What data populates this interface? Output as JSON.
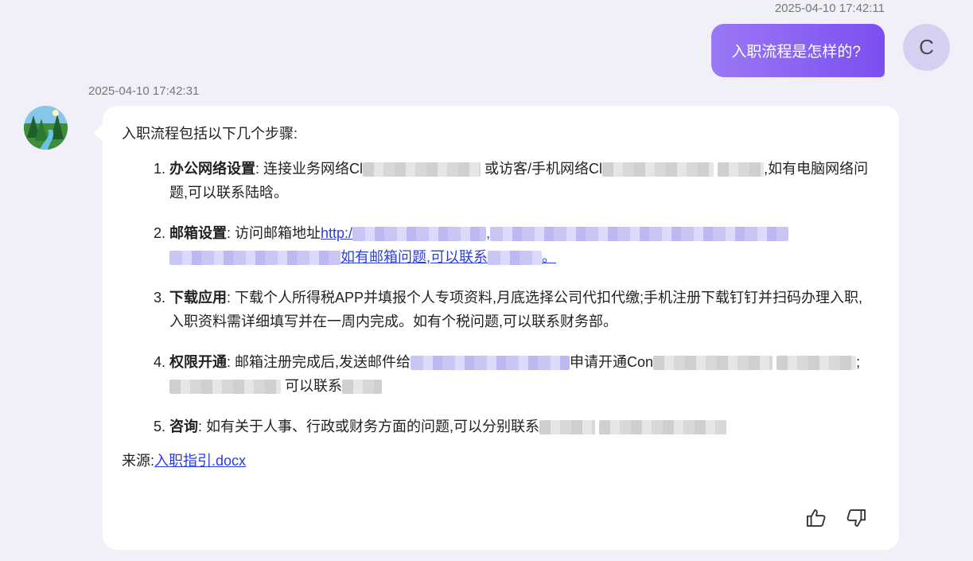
{
  "user_message": {
    "timestamp": "2025-04-10 17:42:11",
    "text": "入职流程是怎样的?",
    "avatar_letter": "C"
  },
  "bot_message": {
    "timestamp": "2025-04-10 17:42:31",
    "intro": "入职流程包括以下几个步骤:",
    "steps": [
      {
        "title": "办公网络设置",
        "sep": ":",
        "text_a": "连接业务网络Cl",
        "text_b": "或访客/手机网络Cl",
        "text_c": ",如有电脑网络问题,可以联系陆晗。"
      },
      {
        "title": "邮箱设置",
        "sep": ":",
        "text_a": "访问邮箱地址",
        "link_a": "http:/",
        "link_b": ",",
        "link_c": "如有邮箱问题,可以联系",
        "link_d": "。"
      },
      {
        "title": "下载应用",
        "sep": ":",
        "text_a": "下载个人所得税APP并填报个人专项资料,月底选择公司代扣代缴;手机注册下载钉钉并扫码办理入职,入职资料需详细填写并在一周内完成。如有个税问题,可以联系财务部。"
      },
      {
        "title": "权限开通",
        "sep": ":",
        "text_a": "邮箱注册完成后,发送邮件给",
        "text_b": "申请开通Con",
        "text_c": ";",
        "text_d": "可以联系"
      },
      {
        "title": "咨询",
        "sep": ":",
        "text_a": "如有关于人事、行政或财务方面的问题,可以分别联系"
      }
    ],
    "source_label": "来源:",
    "source_link": "入职指引.docx"
  },
  "actions": {
    "like_icon": "thumbs-up-icon",
    "dislike_icon": "thumbs-down-icon"
  },
  "colors": {
    "background": "#f1f0f8",
    "user_bubble_start": "#9b78f5",
    "user_bubble_end": "#7b4ff0",
    "link": "#2a3de0",
    "avatar_bg": "#d7cff2"
  }
}
